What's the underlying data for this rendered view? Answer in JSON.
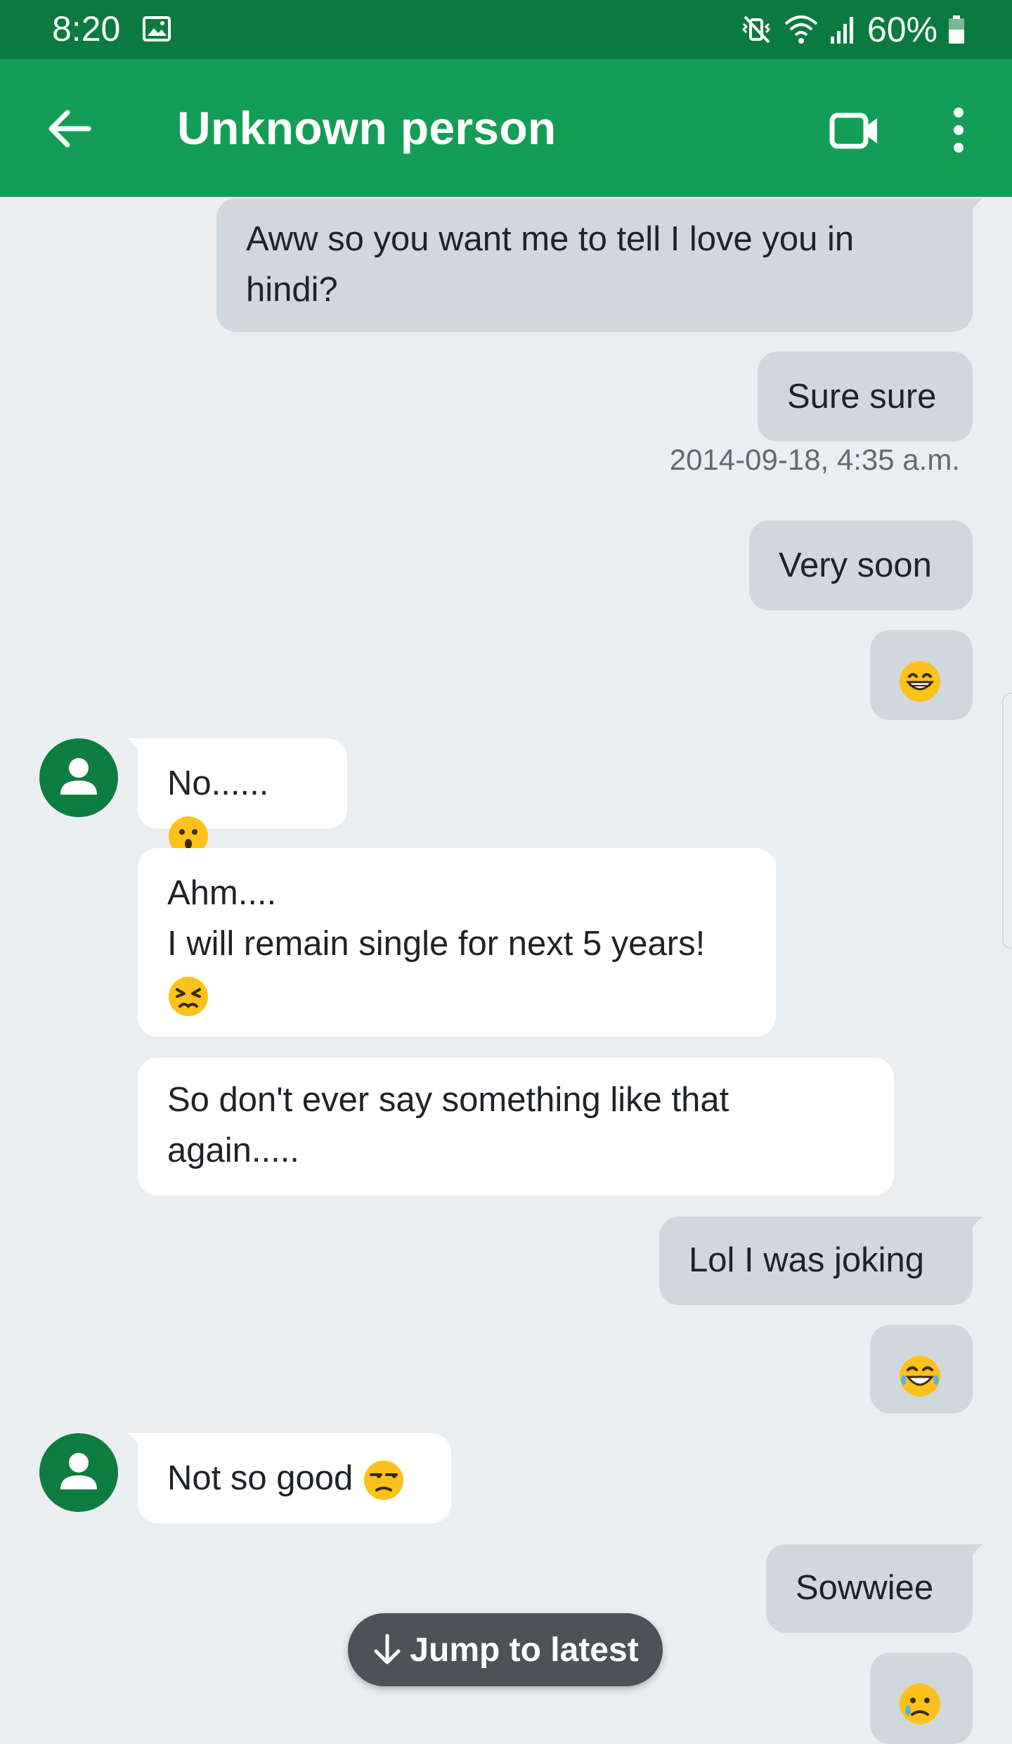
{
  "status_bar": {
    "time": "8:20",
    "battery": "60%"
  },
  "app_bar": {
    "title": "Unknown person"
  },
  "messages": {
    "m1": "Aww so you want me to tell I love you in hindi?",
    "m2": "Sure sure",
    "timestamp": "2014-09-18, 4:35 a.m.",
    "m3": "Very soon",
    "m5": "No......",
    "m6_line1": "Ahm....",
    "m6_line2": "I will remain single for next 5 years!",
    "m7": "So don't ever say something like that again.....",
    "m8": "Lol I was joking",
    "m10": "Not so good",
    "m11": "Sowwiee"
  },
  "jump_to_latest": {
    "label": "Jump to latest"
  },
  "colors": {
    "status_bar": "#0b7a3f",
    "app_bar": "#149e55",
    "outgoing_bubble": "#d0d7dd",
    "incoming_bubble": "#ffffff",
    "background": "#ebeef1"
  },
  "icons": [
    "back-arrow-icon",
    "video-call-icon",
    "more-options-icon",
    "gallery-icon",
    "mute-icon",
    "wifi-icon",
    "signal-icon",
    "battery-icon",
    "avatar-person-icon",
    "arrow-down-icon"
  ],
  "emojis": [
    "grinning-face",
    "hushed-face",
    "persevering-face",
    "face-with-tears-of-joy",
    "unamused-face",
    "crying-face"
  ]
}
